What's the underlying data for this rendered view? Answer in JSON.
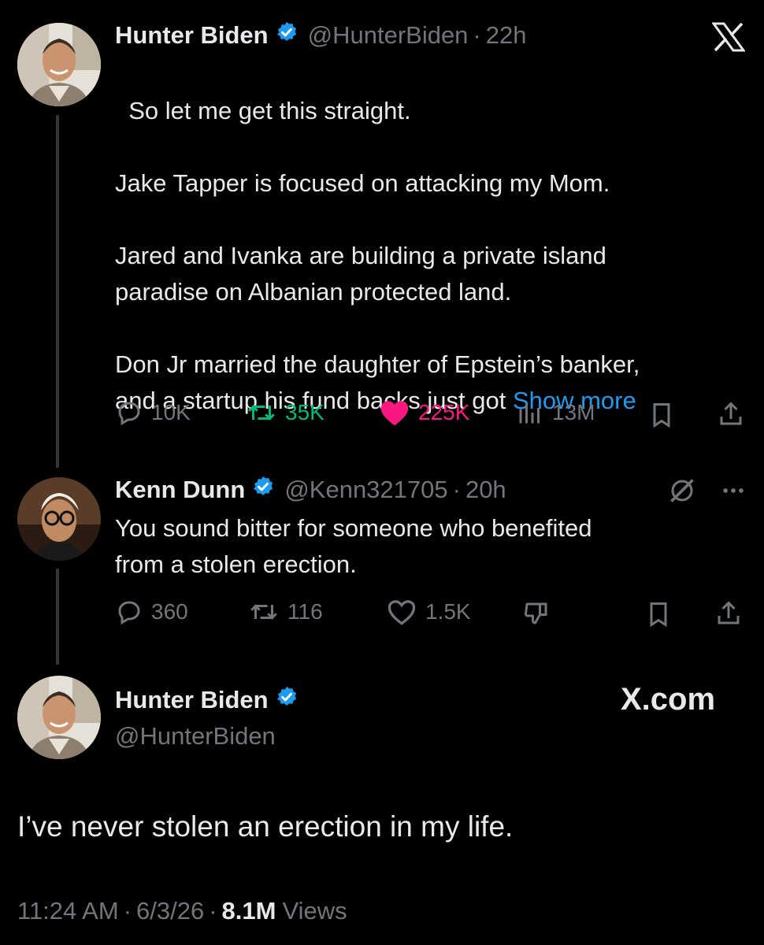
{
  "tweet1": {
    "name": "Hunter Biden",
    "handle": "@HunterBiden",
    "time": "22h",
    "text": "So let me get this straight.\n\nJake Tapper is focused on attacking my Mom.\n\nJared and Ivanka are building a private island\nparadise on Albanian protected land.\n\nDon Jr married the daughter of Epstein’s banker,\nand a startup his fund backs just got",
    "show_more": "Show more",
    "stats": {
      "replies": "10K",
      "reposts": "35K",
      "likes": "225K",
      "views": "13M"
    }
  },
  "tweet2": {
    "name": "Kenn Dunn",
    "handle": "@Kenn321705",
    "time": "20h",
    "text": "You sound bitter for someone who benefited\nfrom a stolen erection.",
    "stats": {
      "replies": "360",
      "reposts": "116",
      "likes": "1.5K"
    }
  },
  "tweet3": {
    "name": "Hunter Biden",
    "handle": "@HunterBiden",
    "brand": "X.com",
    "text": "I’ve never stolen an erection in my life.",
    "time": "11:24 AM",
    "date": "6/3/26",
    "views_count": "8.1M",
    "views_label": "Views"
  },
  "icons": {
    "logo": "x-logo-icon",
    "verified": "verified-badge-icon",
    "reply": "reply-icon",
    "repost": "repost-icon",
    "like": "heart-icon",
    "views": "views-chart-icon",
    "bookmark": "bookmark-icon",
    "share": "share-icon",
    "grok": "grok-icon",
    "more": "more-icon",
    "dislike": "dislike-icon"
  },
  "colors": {
    "background": "#000000",
    "text": "#e7e9ea",
    "muted": "#71767b",
    "accent": "#1d9bf0",
    "repost": "#00ba7c",
    "like": "#f91880"
  }
}
